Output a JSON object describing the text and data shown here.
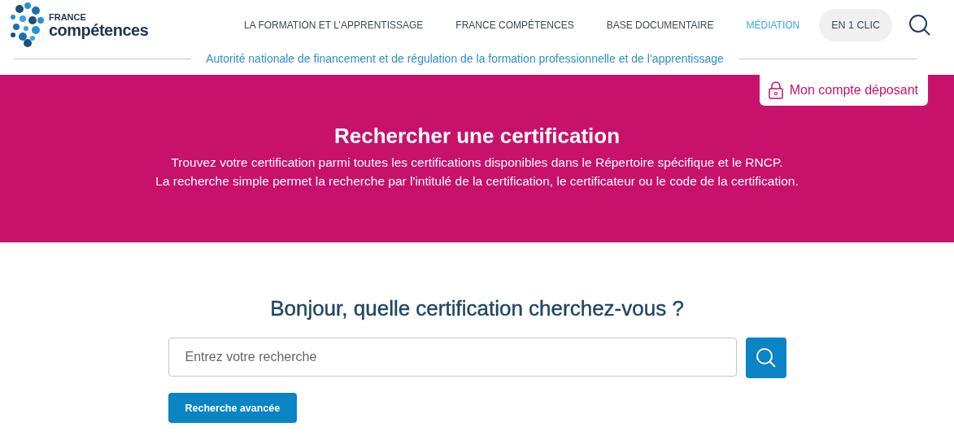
{
  "logo": {
    "line_1": "FRANCE",
    "line_2": "compétences"
  },
  "nav": [
    {
      "label": "LA FORMATION ET L’APPRENTISSAGE",
      "selected": false
    },
    {
      "label": "FRANCE COMPÉTENCES",
      "selected": false
    },
    {
      "label": "BASE DOCUMENTAIRE",
      "selected": false
    },
    {
      "label": "MÉDIATION",
      "selected": true
    }
  ],
  "quick_button": "EN 1 CLIC",
  "tagline": "Autorité nationale de financement et de régulation de la formation professionnelle et de l’apprentissage",
  "account_button": "Mon compte déposant",
  "banner": {
    "title": "Rechercher une certification",
    "lines": [
      "Trouvez votre certification parmi toutes les certifications disponibles dans le Répertoire spécifique et le RNCP.",
      "La recherche simple permet la recherche par l'intitulé de la certification, le certificateur ou le code de la certification."
    ]
  },
  "search": {
    "heading": "Bonjour, quelle certification cherchez-vous ?",
    "placeholder": "Entrez votre recherche",
    "advanced_button": "Recherche avancée"
  }
}
